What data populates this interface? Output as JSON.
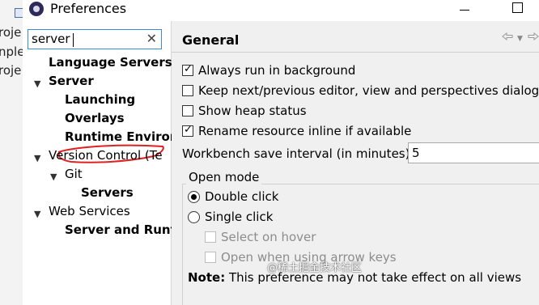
{
  "background_app": {
    "fragments": [
      "roje",
      "nple",
      "roje"
    ]
  },
  "window": {
    "title": "Preferences"
  },
  "filter": {
    "value": "server"
  },
  "tree": {
    "items": [
      {
        "label": "Language Servers",
        "bold": true
      },
      {
        "label": "Server",
        "bold": true,
        "expanded": true
      },
      {
        "label": "Launching",
        "bold": true
      },
      {
        "label": "Overlays",
        "bold": true
      },
      {
        "label": "Runtime Enviror",
        "bold": true,
        "highlighted": true
      },
      {
        "label": "Version Control (Te",
        "bold": false,
        "expanded": true
      },
      {
        "label": "Git",
        "bold": false,
        "expanded": true
      },
      {
        "label": "Servers",
        "bold": true
      },
      {
        "label": "Web Services",
        "bold": false,
        "expanded": true
      },
      {
        "label": "Server and Runt",
        "bold": true
      }
    ]
  },
  "general": {
    "title": "General",
    "checkboxes": [
      {
        "label": "Always run in background",
        "checked": true
      },
      {
        "label": "Keep next/previous editor, view and perspectives dialog o",
        "checked": false
      },
      {
        "label": "Show heap status",
        "checked": false
      },
      {
        "label": "Rename resource inline if available",
        "checked": true
      }
    ],
    "save_interval_label": "Workbench save interval (in minutes):",
    "save_interval_value": "5",
    "open_mode": {
      "title": "Open mode",
      "options": [
        {
          "label": "Double click",
          "selected": true
        },
        {
          "label": "Single click",
          "selected": false
        }
      ],
      "sub_options": [
        {
          "label": "Select on hover",
          "enabled": false
        },
        {
          "label": "Open when using arrow keys",
          "enabled": false
        }
      ]
    },
    "note_prefix": "Note:",
    "note_text": " This preference may not take effect on all views"
  },
  "watermark": "@稀土掘金技术社区",
  "colors": {
    "accent_focus": "#3c8bd6",
    "annotation_red": "#e02020"
  }
}
